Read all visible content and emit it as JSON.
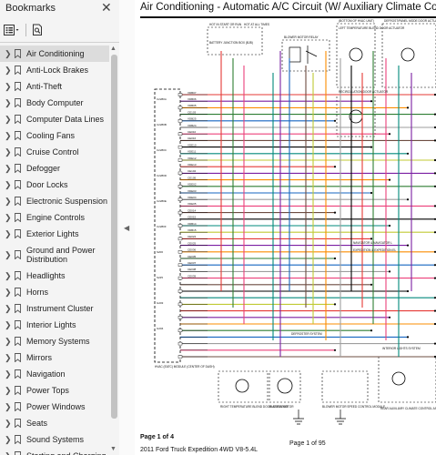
{
  "sidebar": {
    "title": "Bookmarks",
    "items": [
      {
        "label": "Air Conditioning",
        "selected": true
      },
      {
        "label": "Anti-Lock Brakes"
      },
      {
        "label": "Anti-Theft"
      },
      {
        "label": "Body Computer"
      },
      {
        "label": "Computer Data Lines"
      },
      {
        "label": "Cooling Fans"
      },
      {
        "label": "Cruise Control"
      },
      {
        "label": "Defogger"
      },
      {
        "label": "Door Locks"
      },
      {
        "label": "Electronic Suspension"
      },
      {
        "label": "Engine Controls"
      },
      {
        "label": "Exterior Lights"
      },
      {
        "label": "Ground and Power Distribution"
      },
      {
        "label": "Headlights"
      },
      {
        "label": "Horns"
      },
      {
        "label": "Instrument Cluster"
      },
      {
        "label": "Interior Lights"
      },
      {
        "label": "Memory Systems"
      },
      {
        "label": "Mirrors"
      },
      {
        "label": "Navigation"
      },
      {
        "label": "Power Tops"
      },
      {
        "label": "Power Windows"
      },
      {
        "label": "Seats"
      },
      {
        "label": "Sound Systems"
      },
      {
        "label": "Starting and Charging"
      }
    ]
  },
  "document": {
    "title": "Air Conditioning - Automatic A/C Circuit (W/ Auxiliary Climate Control)",
    "page_indicator": "Page 1 of 4",
    "page_counter": "Page 1 of 95",
    "vehicle": "2011 Ford Truck Expedition 4WD V8-5.4L"
  },
  "schematic": {
    "component_labels": [
      "HOT IN START OR RUN",
      "HOT AT ALL TIMES",
      "BATTERY JUNCTION BOX (BJB)",
      "BLOWER MOTOR RELAY",
      "(BOTTOM OF HVAC UNIT)",
      "LEFT TEMPERATURE BLEND DOOR ACTUATOR",
      "DEFROST/PANEL MODE DOOR ACTUATOR",
      "RECIRCULATION DOOR ACTUATOR",
      "HVAC (EATC) MODULE (CENTER OF DASH)",
      "DEFROSTER SYSTEM",
      "RIGHT TEMPERATURE BLEND DOOR ACTUATOR",
      "BLOWER MOTOR",
      "BLOWER MOTOR SPEED CONTROL MODULE",
      "INTERIOR LIGHTS SYSTEM",
      "REAR AUXILIARY CLIMATE CONTROL ASSEMBLY",
      "NAVIGATOR & NAVIGATOR L",
      "EXPEDITION & EXPEDITION EL"
    ],
    "circuit_ids": [
      "VDB07",
      "VDB06",
      "VDB05",
      "CE103",
      "VDB25",
      "VDB24",
      "CE010",
      "CE016",
      "VDE10",
      "VDE11",
      "VDE12",
      "VDE13",
      "CE104",
      "CE105",
      "VDE02",
      "VDE03",
      "VDE04",
      "VDE05",
      "CE014",
      "CE015",
      "VDB14",
      "VDB15",
      "CE024",
      "CE025",
      "CE036",
      "CE035",
      "CE037",
      "CE038",
      "CE039"
    ],
    "connector_ids": [
      "C2280A",
      "C2280B",
      "C2280C",
      "C2280D",
      "C2280E",
      "C2280F",
      "S206",
      "S225",
      "G203",
      "G204"
    ],
    "wire_colors": [
      "#e53935",
      "#7b1fa2",
      "#fb8c00",
      "#2e7d32",
      "#1565c0",
      "#9e9e9e",
      "#ec407a",
      "#6d4c41",
      "#000000",
      "#00897b",
      "#c0ca33"
    ]
  }
}
